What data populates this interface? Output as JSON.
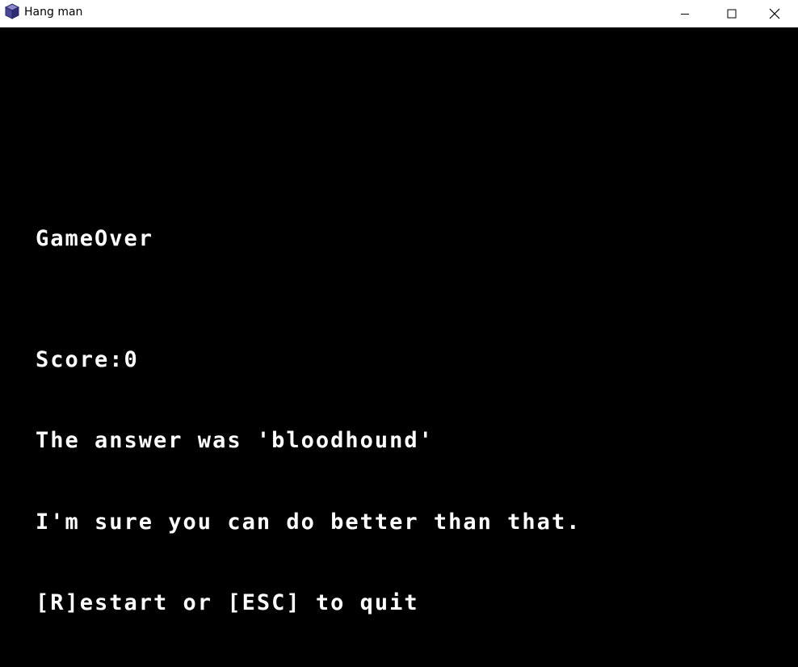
{
  "window": {
    "title": "Hang man",
    "icon": "cube-app-icon",
    "controls": [
      "minimize-icon",
      "maximize-icon",
      "close-icon"
    ]
  },
  "game": {
    "status": "GameOver",
    "score_line": "Score:0",
    "answer_line": "The answer was 'bloodhound'",
    "message": "I'm sure you can do better than that.",
    "prompt": "[R]estart or [ESC] to quit"
  },
  "colors": {
    "background": "#000000",
    "text": "#ffffff",
    "titlebar": "#ffffff"
  }
}
